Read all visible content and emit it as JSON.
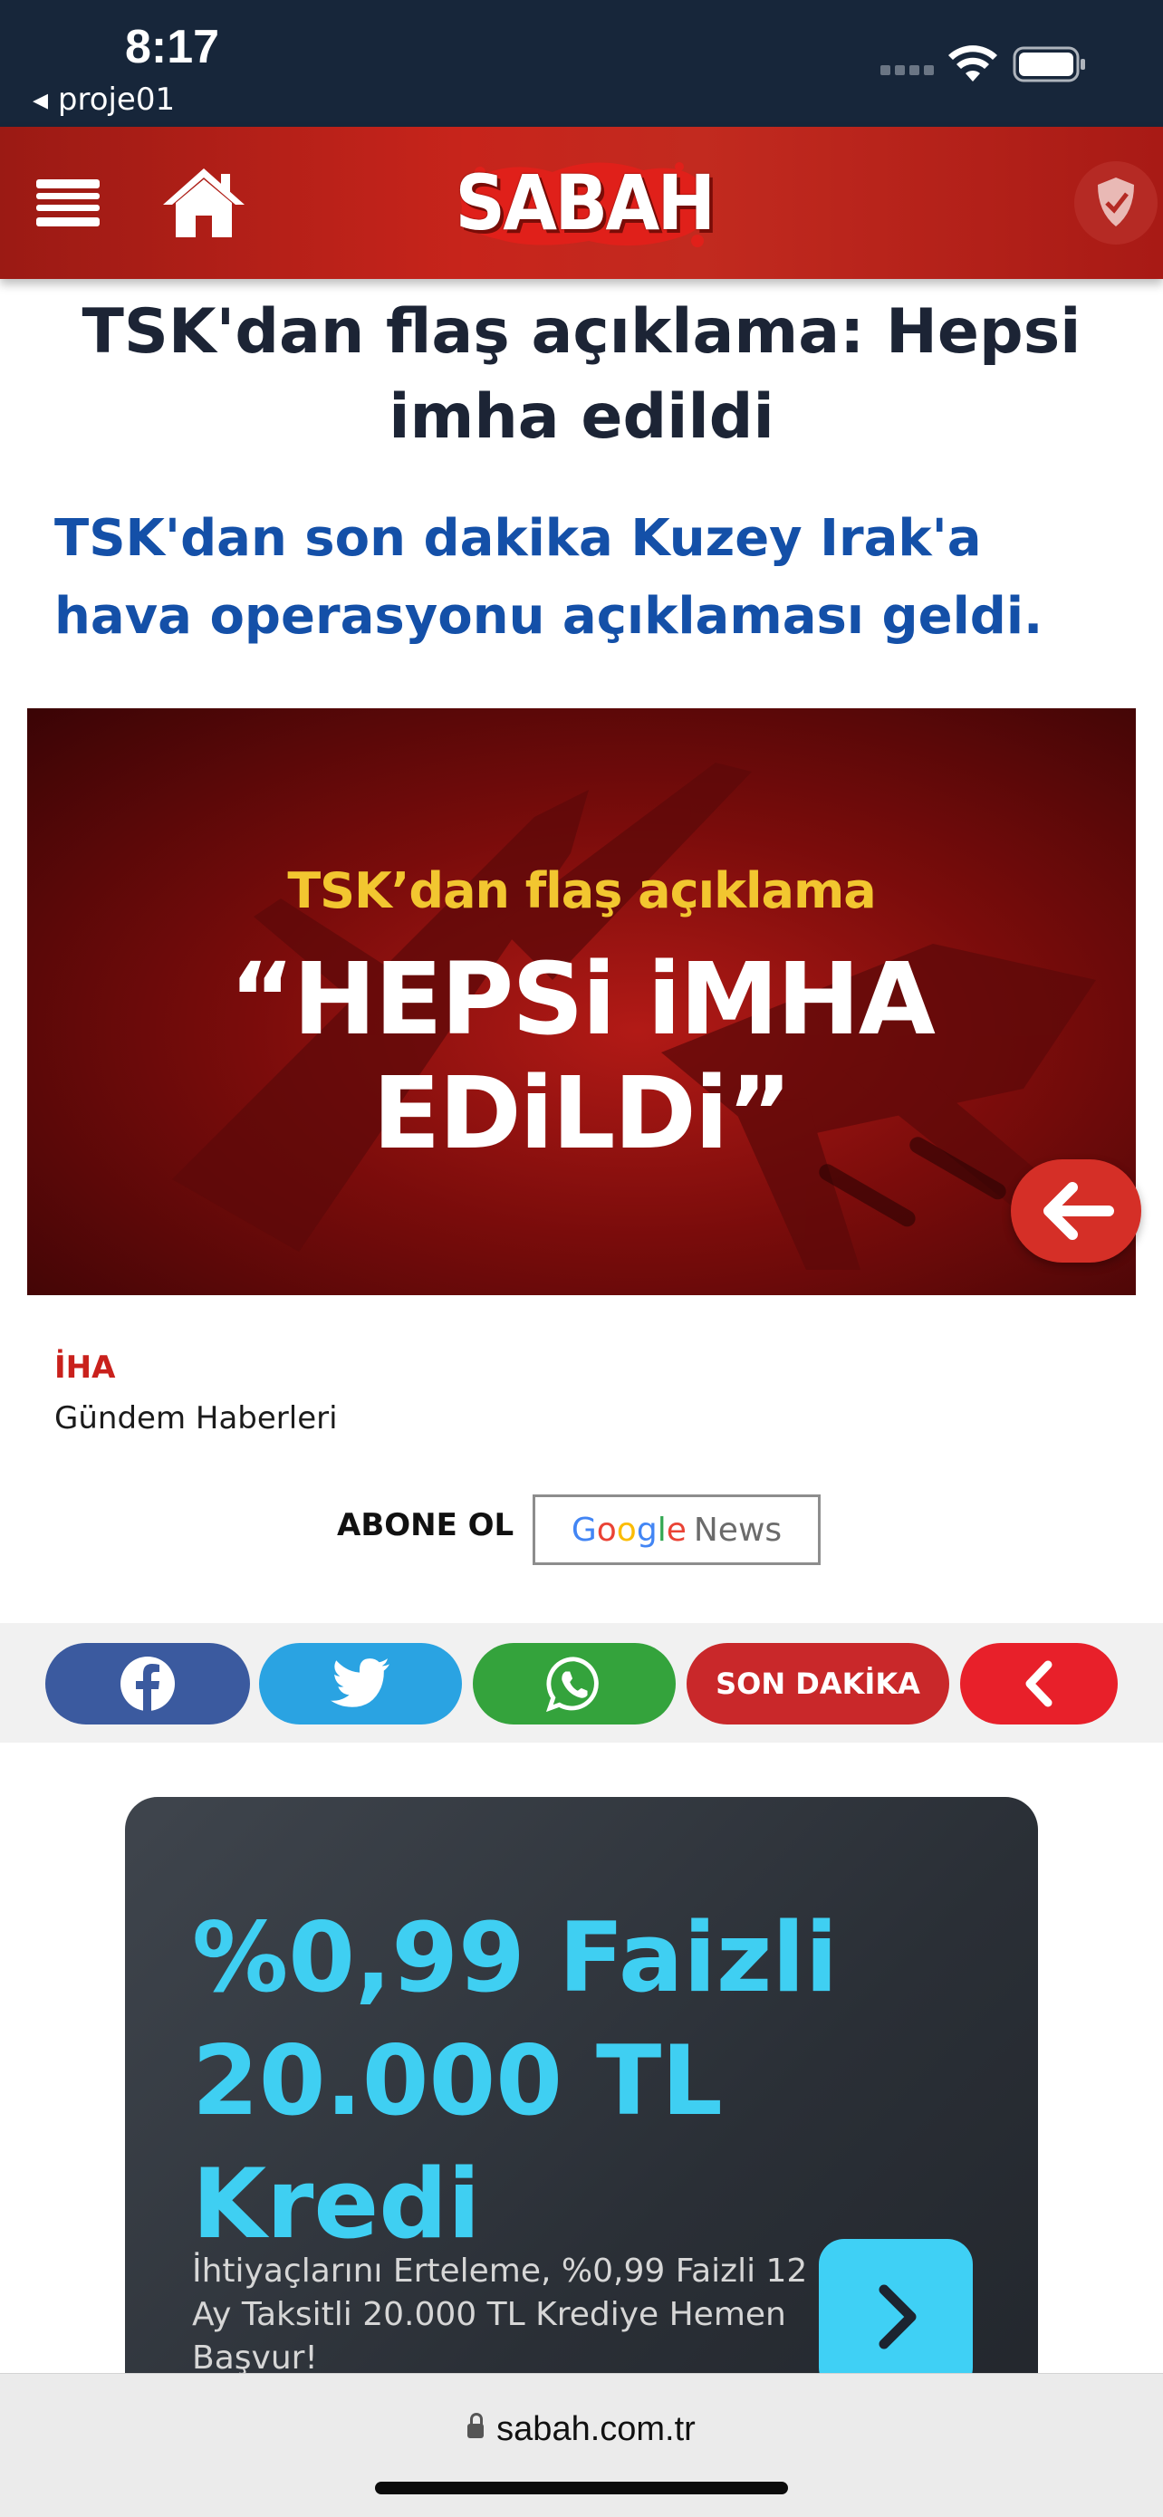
{
  "status_bar": {
    "time": "8:17",
    "back_app": "◂ proje01"
  },
  "header": {
    "logo_text": "SABAH"
  },
  "article": {
    "headline": "TSK'dan flaş açıklama: Hepsi imha edildi",
    "subheadline": "TSK'dan son dakika Kuzey Irak'a hava operasyonu açıklaması geldi.",
    "hero": {
      "top_text": "TSK’dan flaş açıklama",
      "big_text_line1": "“HEPSi iMHA",
      "big_text_line2": "EDiLDi”"
    },
    "source": "İHA",
    "category": "Gündem Haberleri"
  },
  "subscribe": {
    "label": "ABONE OL",
    "google_letters": [
      "G",
      "o",
      "o",
      "g",
      "l",
      "e"
    ],
    "news": "News"
  },
  "share": {
    "son_dakika": "SON DAKİKA"
  },
  "ad": {
    "title_line1": "%0,99 Faizli",
    "title_line2": "20.000 TL Kredi",
    "text": "İhtiyaçlarını Erteleme, %0,99 Faizli 12 Ay Taksitli 20.000 TL Krediye Hemen Başvur!",
    "accent_color": "#3fcff2"
  },
  "browser": {
    "url": "sabah.com.tr"
  },
  "colors": {
    "brand_red": "#c7241b",
    "headline": "#1c2435",
    "subheadline": "#1450a8"
  }
}
